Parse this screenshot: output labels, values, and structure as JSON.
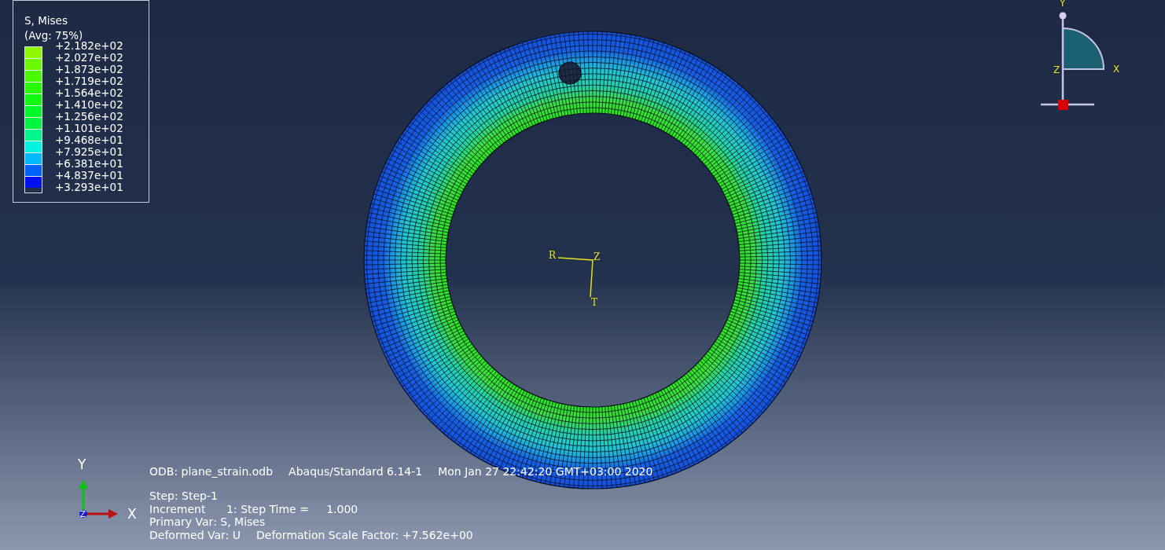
{
  "legend": {
    "title": "S, Mises",
    "subtitle": "(Avg: 75%)",
    "bands": [
      {
        "color": "#8ef800"
      },
      {
        "color": "#6cf800"
      },
      {
        "color": "#48f900"
      },
      {
        "color": "#2afa00"
      },
      {
        "color": "#10fa10"
      },
      {
        "color": "#00f828"
      },
      {
        "color": "#00f540"
      },
      {
        "color": "#00f48c"
      },
      {
        "color": "#00f4e0"
      },
      {
        "color": "#00b8fa"
      },
      {
        "color": "#0060fa"
      },
      {
        "color": "#0010f0"
      }
    ],
    "labels": [
      "+2.182e+02",
      "+2.027e+02",
      "+1.873e+02",
      "+1.719e+02",
      "+1.564e+02",
      "+1.410e+02",
      "+1.256e+02",
      "+1.101e+02",
      "+9.468e+01",
      "+7.925e+01",
      "+6.381e+01",
      "+4.837e+01",
      "+3.293e+01"
    ]
  },
  "view_triad": {
    "y": "Y",
    "z": "Z",
    "x": "X"
  },
  "local_csys": {
    "r": "R",
    "z": "Z",
    "t": "T"
  },
  "global_triad": {
    "y": "Y",
    "x": "X",
    "z": "Z"
  },
  "info": {
    "header": [
      "ODB: plane_strain.odb",
      "Abaqus/Standard 6.14-1",
      "Mon Jan 27 22:42:20 GMT+03:00 2020"
    ],
    "lines": [
      "Step: Step-1",
      "Increment      1: Step Time =     1.000",
      "Primary Var: S, Mises"
    ],
    "deformed": [
      "Deformed Var: U",
      "Deformation Scale Factor: +7.562e+00"
    ]
  }
}
